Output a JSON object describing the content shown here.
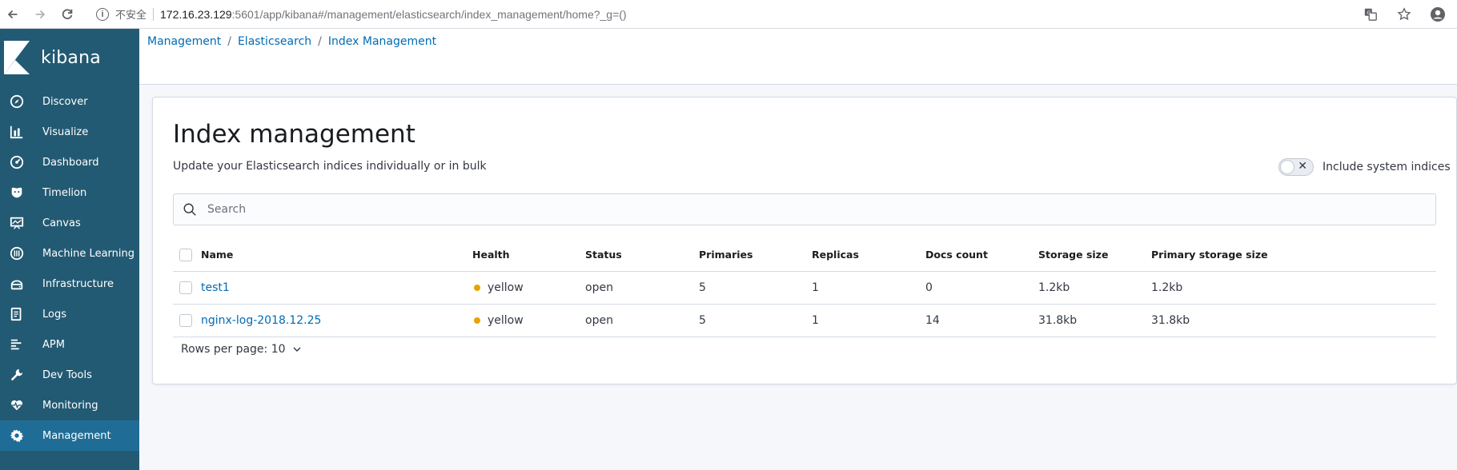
{
  "browser": {
    "insecure_label": "不安全",
    "url_host": "172.16.23.129",
    "url_rest": ":5601/app/kibana#/management/elasticsearch/index_management/home?_g=()"
  },
  "sidebar": {
    "brand": "kibana",
    "items": [
      {
        "label": "Discover",
        "icon": "compass-icon"
      },
      {
        "label": "Visualize",
        "icon": "bar-chart-icon"
      },
      {
        "label": "Dashboard",
        "icon": "dashboard-icon"
      },
      {
        "label": "Timelion",
        "icon": "timelion-icon"
      },
      {
        "label": "Canvas",
        "icon": "canvas-icon"
      },
      {
        "label": "Machine Learning",
        "icon": "machine-learning-icon"
      },
      {
        "label": "Infrastructure",
        "icon": "infrastructure-icon"
      },
      {
        "label": "Logs",
        "icon": "logs-icon"
      },
      {
        "label": "APM",
        "icon": "apm-icon"
      },
      {
        "label": "Dev Tools",
        "icon": "wrench-icon"
      },
      {
        "label": "Monitoring",
        "icon": "heartbeat-icon"
      },
      {
        "label": "Management",
        "icon": "gear-icon"
      }
    ],
    "active": "Management"
  },
  "breadcrumb": [
    "Management",
    "Elasticsearch",
    "Index Management"
  ],
  "page": {
    "title": "Index management",
    "subtitle": "Update your Elasticsearch indices individually or in bulk",
    "toggle_label": "Include system indices",
    "search_placeholder": "Search"
  },
  "table": {
    "columns": [
      "Name",
      "Health",
      "Status",
      "Primaries",
      "Replicas",
      "Docs count",
      "Storage size",
      "Primary storage size"
    ],
    "rows": [
      [
        "test1",
        "yellow",
        "open",
        "5",
        "1",
        "0",
        "1.2kb",
        "1.2kb"
      ],
      [
        "nginx-log-2018.12.25",
        "yellow",
        "open",
        "5",
        "1",
        "14",
        "31.8kb",
        "31.8kb"
      ]
    ]
  },
  "pager": {
    "label": "Rows per page: 10"
  },
  "colors": {
    "sidebar": "#235a73",
    "active": "#1f6d96",
    "link": "#006bb4",
    "health_yellow": "#e7a300"
  }
}
